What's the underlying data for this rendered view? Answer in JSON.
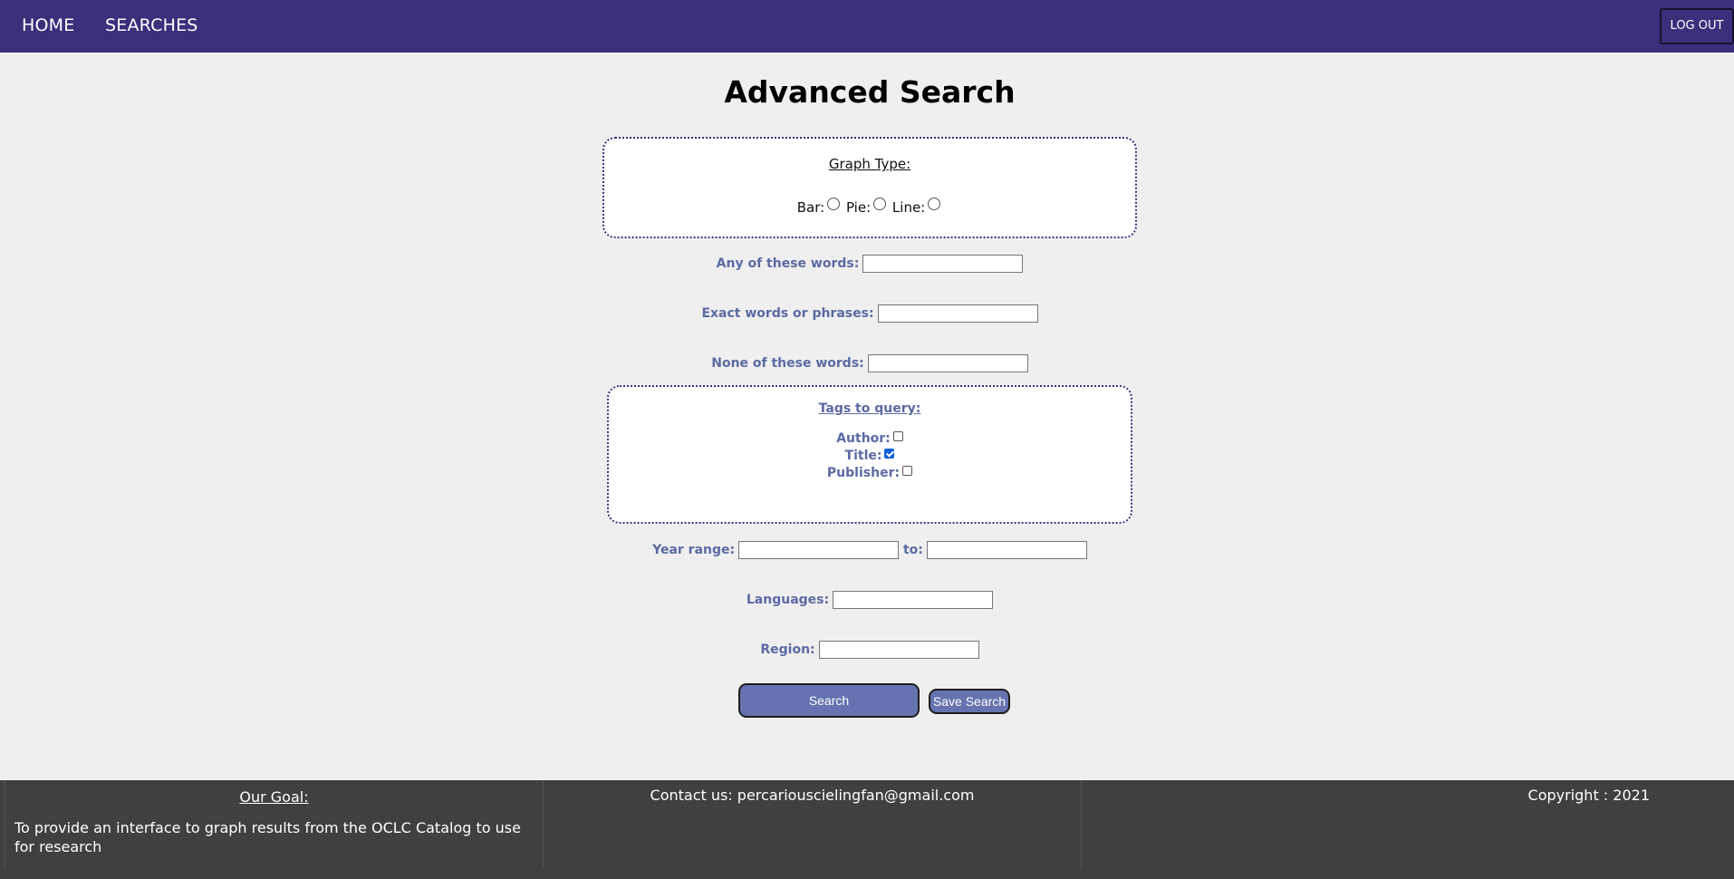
{
  "nav": {
    "home_label": "HOME",
    "searches_label": "SEARCHES",
    "logout_label": "LOG OUT"
  },
  "page_title": "Advanced Search",
  "graph_type": {
    "heading": "Graph Type:",
    "options": [
      "Bar:",
      "Pie:",
      "Line:"
    ]
  },
  "fields": {
    "any_words_label": "Any of these words:",
    "exact_words_label": "Exact words or phrases:",
    "none_words_label": "None of these words:",
    "year_range_label": "Year range:",
    "year_to_label": "to:",
    "languages_label": "Languages:",
    "region_label": "Region:"
  },
  "tags": {
    "heading": "Tags to query:",
    "items": [
      {
        "label": "Author:",
        "checked": false
      },
      {
        "label": "Title:",
        "checked": true
      },
      {
        "label": "Publisher:",
        "checked": false
      }
    ]
  },
  "buttons": {
    "search_label": "Search",
    "save_search_label": "Save Search"
  },
  "footer": {
    "goal_title": "Our Goal:",
    "goal_text": "To provide an interface to graph results from the OCLC Catalog to use for research",
    "contact": "Contact us: percariouscielingfan@gmail.com",
    "copyright": "Copyright : 2021"
  },
  "colors": {
    "nav_bg": "#3b2f7c",
    "label_color": "#5b6aa3",
    "button_bg": "#6673b0",
    "footer_bg": "#404040",
    "page_bg": "#efefef"
  }
}
